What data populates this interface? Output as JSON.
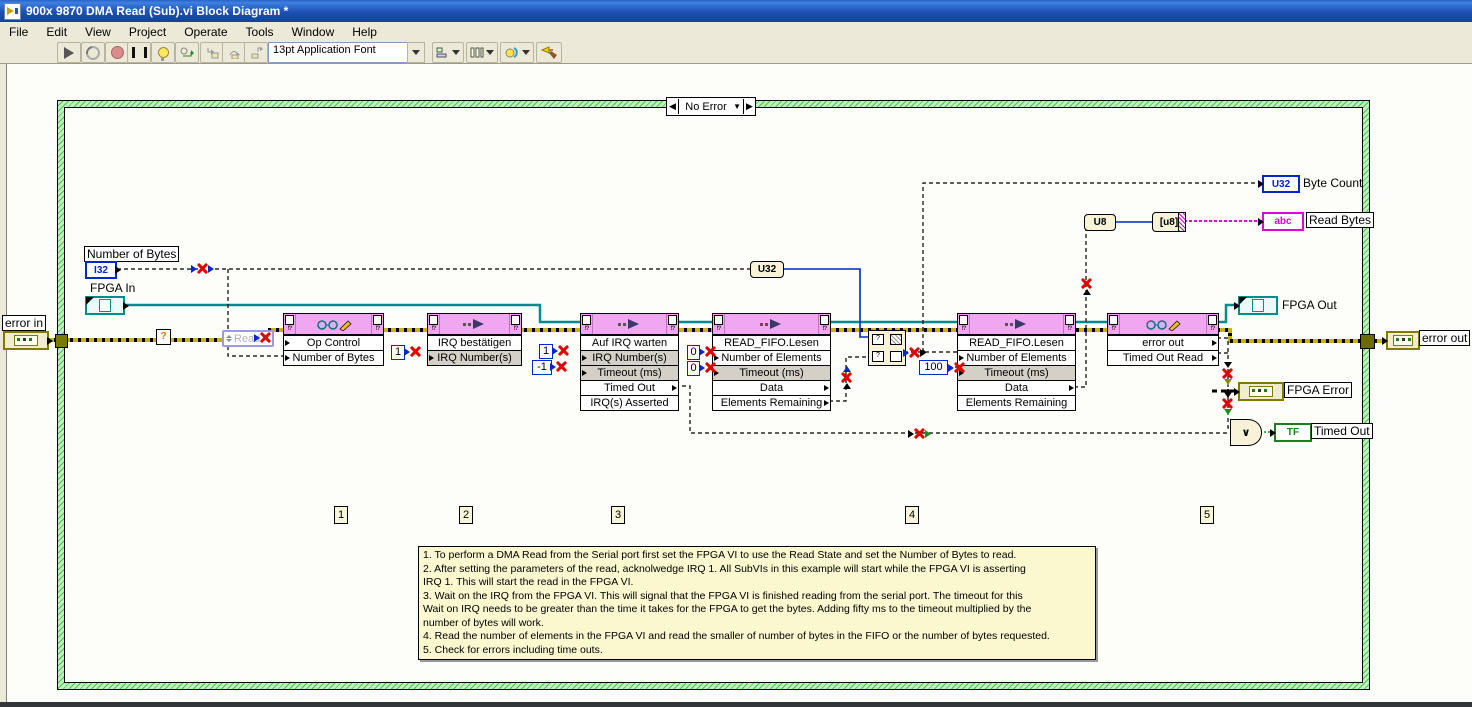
{
  "window": {
    "title": "900x 9870 DMA Read (Sub).vi Block Diagram *"
  },
  "menu": {
    "items": [
      "File",
      "Edit",
      "View",
      "Project",
      "Operate",
      "Tools",
      "Window",
      "Help"
    ]
  },
  "toolbar": {
    "font_selector": "13pt Application Font"
  },
  "case_structure": {
    "selector_label": "No Error"
  },
  "icons": {
    "selector_prev": "◀",
    "selector_next": "▶",
    "selector_dropdown": "▼",
    "or_gate": "∨",
    "question_tunnel": "?",
    "error_corner": "!?",
    "select_question": "?"
  },
  "controls": {
    "number_of_bytes": {
      "label": "Number of Bytes",
      "datatype": "I32"
    },
    "fpga_in": {
      "label": "FPGA In"
    },
    "error_in": {
      "label": "error in"
    }
  },
  "indicators": {
    "byte_count": {
      "label": "Byte Count",
      "datatype": "U32"
    },
    "read_bytes": {
      "label": "Read Bytes",
      "datatype": "abc"
    },
    "fpga_out": {
      "label": "FPGA Out"
    },
    "error_out": {
      "label": "error out"
    },
    "fpga_error": {
      "label": "FPGA Error"
    },
    "timed_out": {
      "label": "Timed Out",
      "datatype": "TF"
    }
  },
  "constants": {
    "read_state": "Read",
    "ack_irq_number": "1",
    "wait_irq_number": "1",
    "wait_timeout": "-1",
    "fifo1_elements": "0",
    "fifo1_timeout": "0",
    "fifo2_timeout": "100"
  },
  "conversions": {
    "to_u32": "U32",
    "to_u8": "U8",
    "to_string": "[u8]"
  },
  "nodes": [
    {
      "id": "op-control",
      "rows": [
        "Op Control",
        "Number of Bytes"
      ]
    },
    {
      "id": "irq-acknowledge",
      "rows": [
        "IRQ bestätigen",
        "IRQ Number(s)"
      ]
    },
    {
      "id": "irq-wait",
      "rows": [
        "Auf IRQ warten",
        "IRQ Number(s)",
        "Timeout (ms)",
        "Timed Out",
        "IRQ(s) Asserted"
      ]
    },
    {
      "id": "fifo-read-1",
      "rows": [
        "READ_FIFO.Lesen",
        "Number of Elements",
        "Timeout (ms)",
        "Data",
        "Elements Remaining"
      ]
    },
    {
      "id": "fifo-read-2",
      "rows": [
        "READ_FIFO.Lesen",
        "Number of Elements",
        "Timeout (ms)",
        "Data",
        "Elements Remaining"
      ]
    },
    {
      "id": "error-read",
      "rows": [
        "error out",
        "Timed Out Read"
      ]
    }
  ],
  "step_labels": [
    "1",
    "2",
    "3",
    "4",
    "5"
  ],
  "comment": {
    "text": "1. To perform a DMA Read from the Serial port first set the FPGA VI to use the Read State and set the Number of Bytes to read.\n2. After setting the parameters of the read, acknolwedge IRQ 1.  All SubVIs in this example will start while the FPGA VI is asserting\nIRQ 1.  This will start the read in the FPGA VI.\n3. Wait on the IRQ from the FPGA VI.  This will signal that the FPGA VI is finished reading from the serial port.  The timeout for this\nWait on IRQ needs to be greater than the time it takes for the FPGA to get the bytes.  Adding fifty ms to the timeout multiplied by the\nnumber of bytes will work.\n4. Read the number of elements in the FPGA VI and read the smaller of number of bytes in the FIFO or the number of bytes requested.\n5. Check for errors including time outs."
  },
  "colors": {
    "node_header": "#f0a6f0",
    "wire_error": "#c8b400",
    "wire_fpga": "#008c8c",
    "wire_numeric": "#0026cc",
    "wire_string": "#e600e6",
    "frame_green": "#4fbf4f",
    "note_bg": "#fbf7cf",
    "titlebar_blue": "#1c50b4"
  }
}
